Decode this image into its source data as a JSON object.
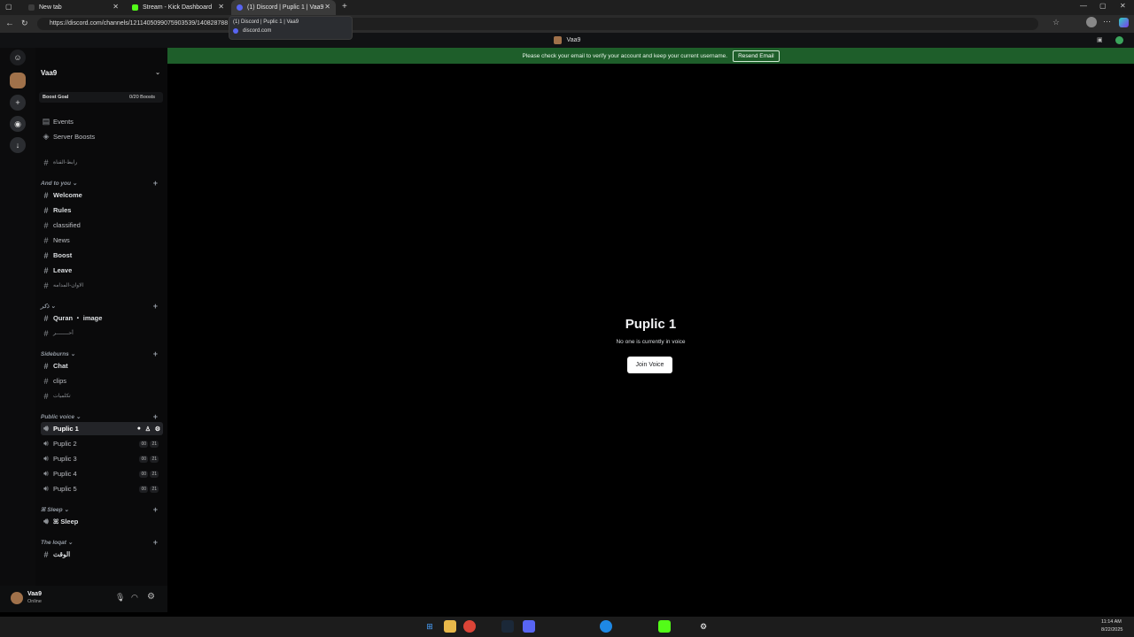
{
  "browser": {
    "tabs": [
      {
        "title": "New tab",
        "color": "#3c3c3c"
      },
      {
        "title": "Stream - Kick Dashboard",
        "color": "#53fc18"
      },
      {
        "title": "(1) Discord | Puplic 1 | Vaa9",
        "color": "#5865f2"
      }
    ],
    "url": "https://discord.com/channels/1211405099075903539/140828788",
    "tooltip": {
      "title": "(1) Discord | Puplic 1 | Vaa9",
      "domain": "discord.com"
    },
    "window_title": "Vaa9"
  },
  "server": {
    "name": "Vaa9",
    "boost_goal": "Boost Goal",
    "boost_count": "0/20 Boosts",
    "events": "Events",
    "server_boosts": "Server Boosts"
  },
  "channels": {
    "top": "رابط-القناة",
    "cat1": "And to you",
    "c1": [
      "Welcome",
      "Rules",
      "classified",
      "News",
      "Boost",
      "Leave",
      "الاوان-المدامه"
    ],
    "cat2": "ذكر",
    "c2": [
      "Quran ・ image",
      "أحــــــــر"
    ],
    "cat3": "Sideburns",
    "c3": [
      "Chat",
      "clips",
      "تكلميات"
    ],
    "cat4": "Public voice",
    "voice": [
      "Puplic 1",
      "Puplic 2",
      "Puplic 3",
      "Puplic 4",
      "Puplic 5"
    ],
    "voice_count_a": "00",
    "voice_count_b": "21",
    "cat5": "ꕤ Sleep",
    "sleep": "ꕤ Sleep",
    "cat6": "The loqat",
    "loqat": "الوقت"
  },
  "banner": {
    "text": "Please check your email to verify your account and keep your current username.",
    "button": "Resend Email"
  },
  "main": {
    "title": "Puplic 1",
    "subtitle": "No one is currently in voice",
    "join": "Join Voice"
  },
  "user": {
    "name": "Vaa9",
    "status": "Online"
  },
  "clock": {
    "time": "11:14 AM",
    "date": "8/22/2025"
  },
  "colors": {
    "banner": "#1e5e2a",
    "accent": "#5865f2"
  }
}
